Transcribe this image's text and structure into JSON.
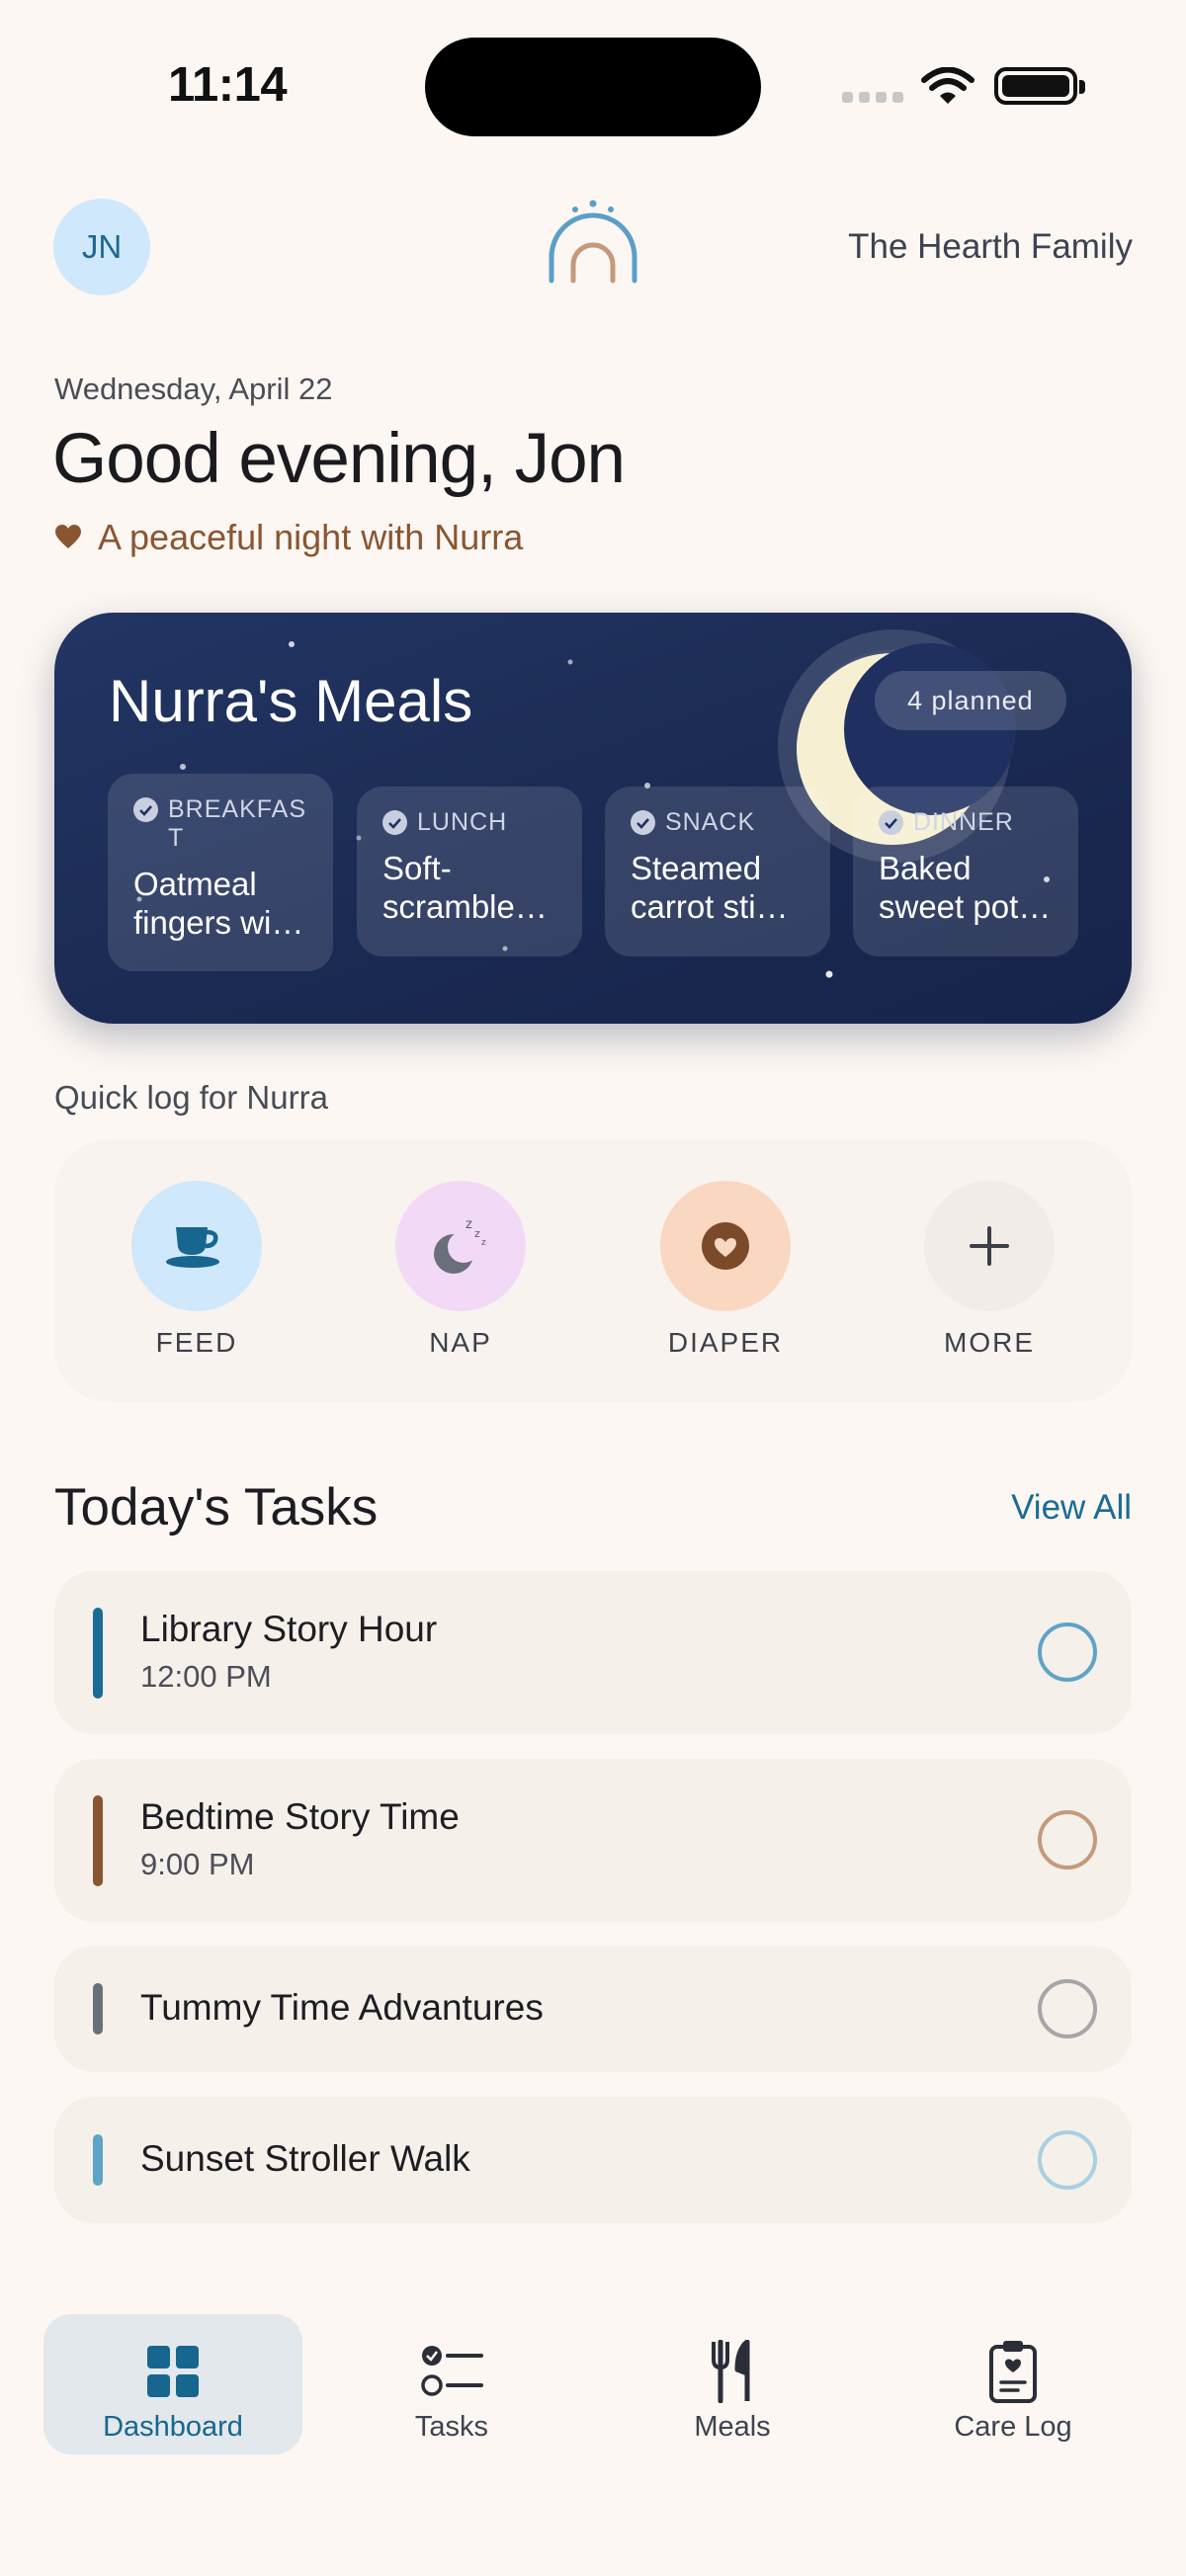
{
  "status_bar": {
    "time": "11:14"
  },
  "header": {
    "avatar_initials": "JN",
    "family_name": "The Hearth Family"
  },
  "hero": {
    "date": "Wednesday, April 22",
    "greeting": "Good evening, Jon",
    "subtitle": "A peaceful night with Nurra"
  },
  "meals": {
    "title": "Nurra's Meals",
    "badge": "4 planned",
    "items": [
      {
        "label": "BREAKFAST",
        "name": "Oatmeal fingers wi…"
      },
      {
        "label": "LUNCH",
        "name": "Soft-scramble…"
      },
      {
        "label": "SNACK",
        "name": "Steamed carrot sti…"
      },
      {
        "label": "DINNER",
        "name": "Baked sweet pot…"
      }
    ]
  },
  "quick_log": {
    "title": "Quick log for Nurra",
    "actions": [
      {
        "label": "FEED",
        "icon": "cup-icon",
        "color": "#cfe8fb"
      },
      {
        "label": "NAP",
        "icon": "moon-zzz-icon",
        "color": "#f2daf7"
      },
      {
        "label": "DIAPER",
        "icon": "heart-icon",
        "color": "#fad7c1"
      },
      {
        "label": "MORE",
        "icon": "plus-icon",
        "color": "#f1ece7"
      }
    ]
  },
  "tasks": {
    "title": "Today's Tasks",
    "view_all": "View All",
    "items": [
      {
        "title": "Library Story Hour",
        "time": "12:00 PM",
        "accent": "#1a6b95"
      },
      {
        "title": "Bedtime Story Time",
        "time": "9:00 PM",
        "accent": "#8a5632"
      },
      {
        "title": "Tummy Time Advantures",
        "accent": "#6b6f7c"
      },
      {
        "title": "Sunset Stroller Walk",
        "accent": "#5fa3c6"
      }
    ]
  },
  "nav": {
    "items": [
      {
        "label": "Dashboard",
        "icon": "grid-icon",
        "active": true
      },
      {
        "label": "Tasks",
        "icon": "checklist-icon"
      },
      {
        "label": "Meals",
        "icon": "fork-knife-icon"
      },
      {
        "label": "Care Log",
        "icon": "clipboard-heart-icon"
      }
    ]
  },
  "colors": {
    "background": "#fcf7f2",
    "primary": "#1a6b95",
    "accent_brown": "#8a5632",
    "meals_card": "#1b2a53"
  }
}
